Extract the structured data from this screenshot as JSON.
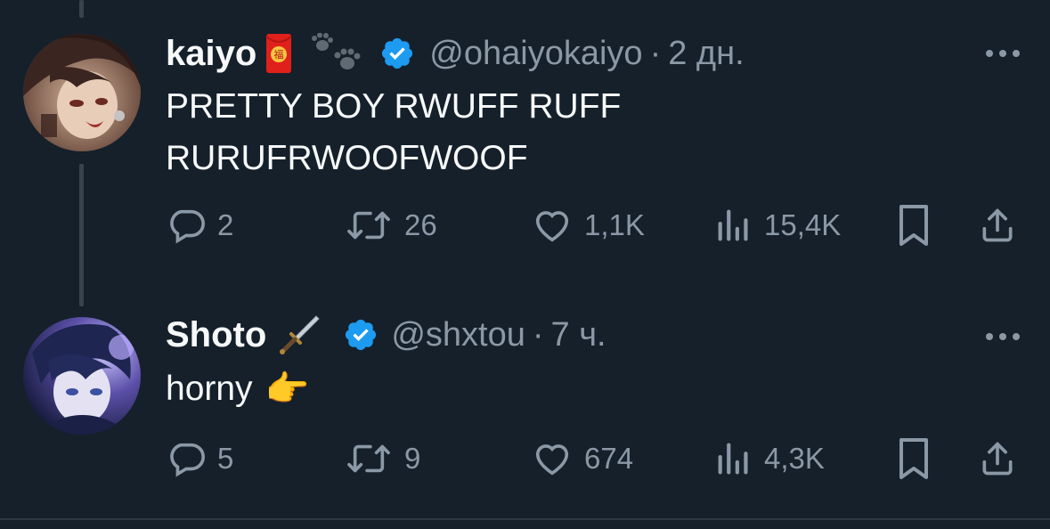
{
  "colors": {
    "background": "#15202b",
    "text": "#f7f9f9",
    "muted": "#8b98a5",
    "verified": "#1d9bf0"
  },
  "tweets": [
    {
      "name": "kaiyo",
      "badges": [
        "red-envelope-icon",
        "paw-prints-icon"
      ],
      "handle": "@ohaiyokaiyo",
      "separator": "·",
      "time": "2 дн.",
      "text_lines": [
        "PRETTY BOY RWUFF RUFF",
        "RURUFRWOOFWOOF"
      ],
      "replies": "2",
      "retweets": "26",
      "likes": "1,1K",
      "views": "15,4K"
    },
    {
      "name": "Shoto",
      "badges": [
        "dagger-icon"
      ],
      "handle": "@shxtou",
      "separator": "·",
      "time": "7 ч.",
      "text": "horny",
      "emoji": "👉",
      "replies": "5",
      "retweets": "9",
      "likes": "674",
      "views": "4,3K"
    }
  ]
}
